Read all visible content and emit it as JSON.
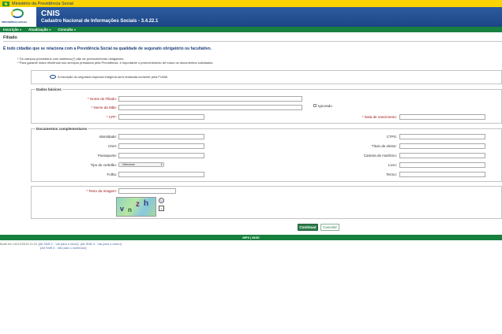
{
  "gov_bar": {
    "text": "Ministério da Previdência Social"
  },
  "header": {
    "logo_text": "PREVIDÊNCIA SOCIAL",
    "title": "CNIS",
    "subtitle": "Cadastro Nacional de Informações Sociais - 3.4.22.1"
  },
  "menu": {
    "items": [
      {
        "label": "Inscrição"
      },
      {
        "label": "Atualização"
      },
      {
        "label": "Consulta"
      }
    ]
  },
  "page": {
    "title": "Filiado",
    "intro": "É todo cidadão que se relaciona com a Previdência Social na qualidade de segurado obrigatório ou facultativo.",
    "note1": "* Os campos precedidos com asterisco(*) são de preenchimento obrigatório.",
    "note2": "* Para garantir maior eficiência nos serviços prestados pela Previdência, é importante o preenchimento de todos os documentos solicitados.",
    "info": "A inscrição do segurado especial indígena será realizada somente pela FUNAI"
  },
  "dados_basicos": {
    "legend": "Dados básicos",
    "nome_filiado_label": "Nome do Filiado:",
    "nome_mae_label": "Nome da Mãe:",
    "ignorado_label": "Ignorado",
    "cpf_label": "CPF:",
    "data_nascimento_label": "Data de nascimento:"
  },
  "documentos": {
    "legend": "Documentos complementares",
    "identidade_label": "Identidade:",
    "cnh_label": "CNH:",
    "passaporte_label": "Passaporte:",
    "tipo_certidao_label": "Tipo de certidão:",
    "tipo_certidao_value": "- Selecione -",
    "folha_label": "Folha:",
    "ctps_label": "CTPS:",
    "titulo_eleitor_label": "Título de eleitor:",
    "carteira_maritimo_label": "Carteira de marítimo:",
    "livro_label": "Livro:",
    "termo_label": "Termo:"
  },
  "captcha": {
    "label": "Texto da Imagem:",
    "chars": [
      "v",
      "n",
      "z",
      "h"
    ],
    "refresh_icon": "refresh-icon",
    "audio_icon": "speaker-icon"
  },
  "buttons": {
    "continuar": "Continuar",
    "cancelar": "Cancelar"
  },
  "footer": {
    "bar_text": "MPS | INSS",
    "build_prefix": "Build em 16/12/2016 11:01 [",
    "link1": "All Shift 2 - Vai para o inicio",
    "link2": "Alt Shift 3 - Vai para o menu",
    "link3": "Alt Shift 4 - Vai para o conteúdo"
  },
  "colors": {
    "gov_yellow": "#fbd300",
    "header_blue": "#1d4585",
    "menu_green": "#16803e",
    "required_red": "#a01818"
  }
}
